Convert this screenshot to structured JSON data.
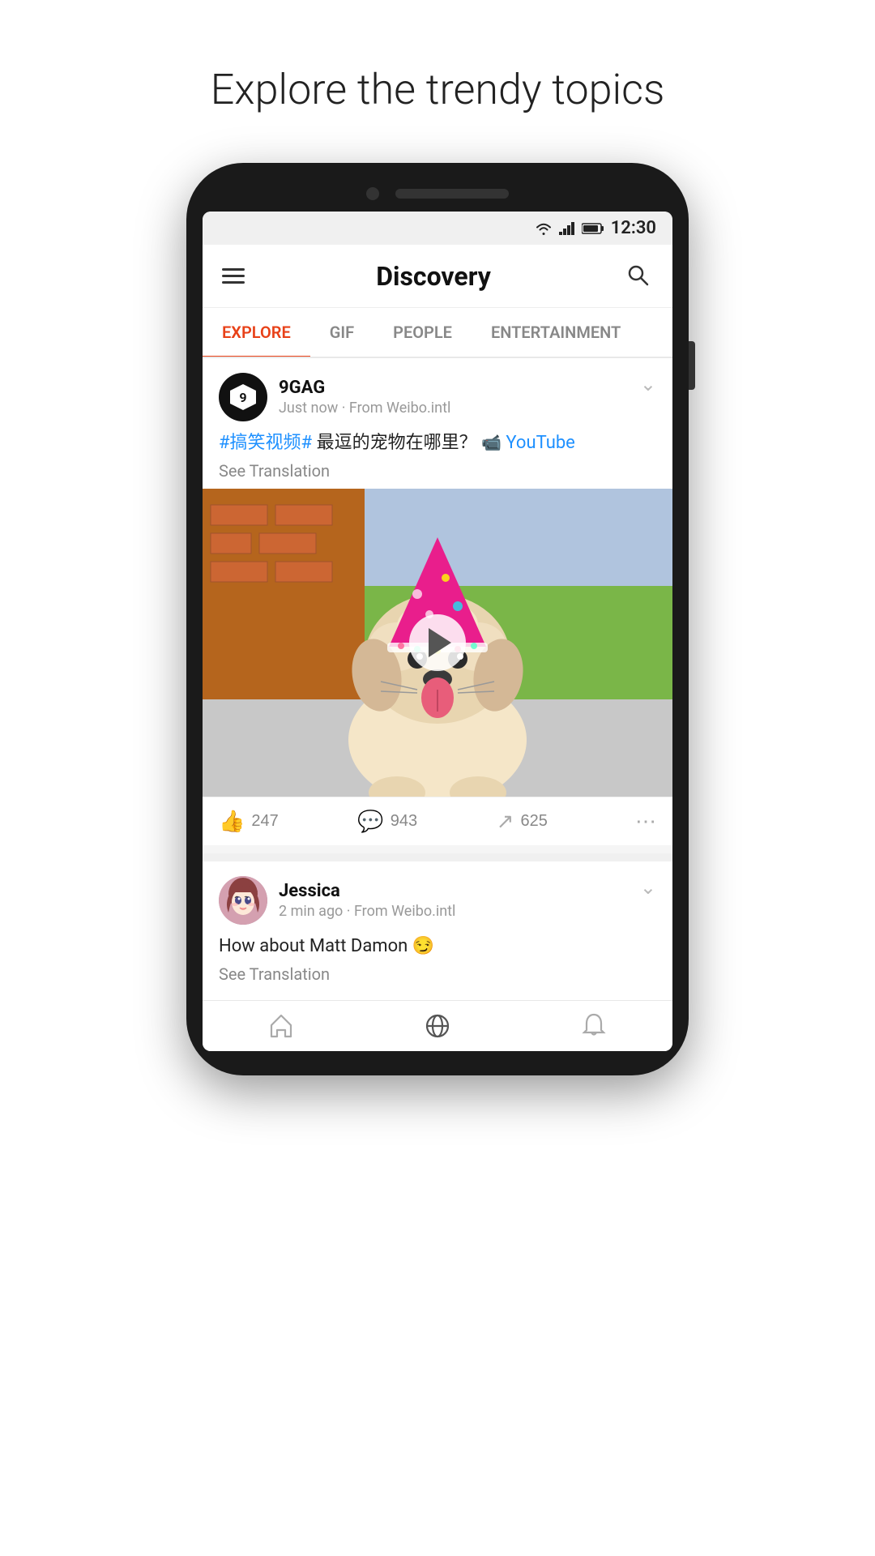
{
  "page": {
    "headline": "Explore the trendy topics"
  },
  "status_bar": {
    "time": "12:30",
    "wifi": "▼",
    "signal": "▲",
    "battery": "🔋"
  },
  "header": {
    "title": "Discovery",
    "menu_label": "Menu",
    "search_label": "Search"
  },
  "tabs": [
    {
      "label": "EXPLORE",
      "active": true
    },
    {
      "label": "GIF",
      "active": false
    },
    {
      "label": "PEOPLE",
      "active": false
    },
    {
      "label": "ENTERTAINMENT",
      "active": false
    }
  ],
  "posts": [
    {
      "id": "post-1",
      "author_name": "9GAG",
      "author_meta": "Just now · From Weibo.intl",
      "content_text": "#搞笑视频# 最逗的宠物在哪里？",
      "youtube_label": "YouTube",
      "see_translation": "See Translation",
      "likes": "247",
      "comments": "943",
      "shares": "625",
      "has_video": true
    },
    {
      "id": "post-2",
      "author_name": "Jessica",
      "author_meta": "2 min ago · From Weibo.intl",
      "content_text": "How about Matt Damon 😏",
      "see_translation": "See Translation",
      "has_video": false
    }
  ],
  "bottom_nav": [
    {
      "label": "Home",
      "icon": "home"
    },
    {
      "label": "Discover",
      "icon": "discover"
    },
    {
      "label": "Notifications",
      "icon": "bell"
    }
  ],
  "colors": {
    "accent_red": "#e84118",
    "link_blue": "#1e90ff",
    "text_primary": "#111111",
    "text_secondary": "#888888",
    "tab_active": "#e84118"
  }
}
